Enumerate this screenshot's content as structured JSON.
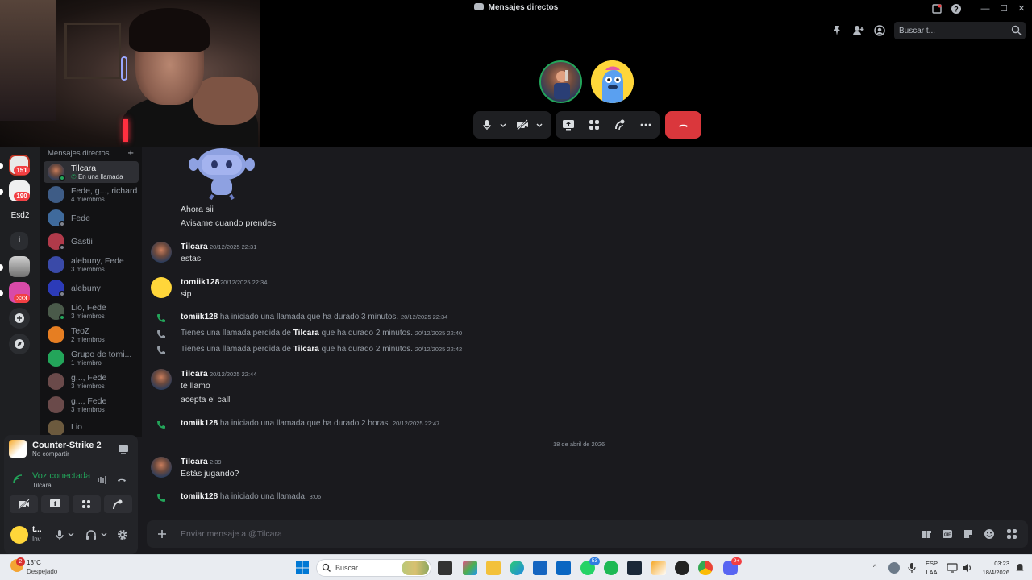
{
  "window": {
    "title": "Mensajes directos"
  },
  "header": {
    "search_placeholder": "Buscar t..."
  },
  "servers": [
    {
      "badge": "151"
    },
    {
      "badge": "190"
    },
    {
      "label": "Esd2"
    },
    {
      "label": "i"
    },
    {
      "badge": ""
    },
    {
      "badge": "333"
    }
  ],
  "sidebar": {
    "header": "Mensajes directos",
    "items": [
      {
        "name": "Tilcara",
        "sub": "En una llamada",
        "active": true
      },
      {
        "name": "Fede, g..., richard",
        "sub": "4 miembros"
      },
      {
        "name": "Fede",
        "sub": ""
      },
      {
        "name": "Gastii",
        "sub": ""
      },
      {
        "name": "alebuny, Fede",
        "sub": "3 miembros"
      },
      {
        "name": "alebuny",
        "sub": ""
      },
      {
        "name": "Lio, Fede",
        "sub": "3 miembros"
      },
      {
        "name": "TeoZ",
        "sub": "2 miembros"
      },
      {
        "name": "Grupo de tomi...",
        "sub": "1 miembro"
      },
      {
        "name": "g..., Fede",
        "sub": "3 miembros"
      },
      {
        "name": "g..., Fede",
        "sub": "3 miembros"
      },
      {
        "name": "Lio",
        "sub": ""
      }
    ]
  },
  "activity": {
    "game": "Counter-Strike 2",
    "sub": "No compartir"
  },
  "voice": {
    "label": "Voz conectada",
    "channel": "Tilcara"
  },
  "user": {
    "name": "t...",
    "status": "Inv..."
  },
  "chat": {
    "messages": [
      {
        "text1": "Ahora sii",
        "text2": "Avisame cuando prendes"
      },
      {
        "author": "Tilcara",
        "time": "20/12/2025 22:31",
        "text": "estas"
      },
      {
        "author": "tomiik128",
        "time": "20/12/2025 22:34",
        "text": "sip"
      },
      {
        "author": "Tilcara",
        "time": "20/12/2025 22:44",
        "text1": "te llamo",
        "text2": "acepta el call"
      },
      {
        "author": "Tilcara",
        "time": "2:39",
        "text": "Estás jugando?"
      }
    ],
    "system": [
      {
        "actor": "tomiik128",
        "text": " ha iniciado una llamada que ha durado 3 minutos. ",
        "time": "20/12/2025 22:34"
      },
      {
        "prefix": "Tienes una llamada perdida de ",
        "actor": "Tilcara",
        "text": " que ha durado 2 minutos. ",
        "time": "20/12/2025 22:40"
      },
      {
        "prefix": "Tienes una llamada perdida de ",
        "actor": "Tilcara",
        "text": " que ha durado 2 minutos. ",
        "time": "20/12/2025 22:42"
      },
      {
        "actor": "tomiik128",
        "text": " ha iniciado una llamada que ha durado 2 horas. ",
        "time": "20/12/2025 22:47"
      },
      {
        "actor": "tomiik128",
        "text": " ha iniciado una llamada. ",
        "time": "3:06"
      }
    ],
    "date_divider": "18 de abril de 2026"
  },
  "composer": {
    "placeholder": "Enviar mensaje a @Tilcara"
  },
  "taskbar": {
    "weather_badge": "2",
    "temp": "13°C",
    "weather": "Despejado",
    "search": "Buscar",
    "whatsapp_badge": "53",
    "discord_badge": "9+",
    "lang1": "ESP",
    "lang2": "LAA",
    "time": "03:23",
    "date": "18/4/2026"
  },
  "colors": {
    "accent_green": "#23a55a",
    "end_call_red": "#da373c",
    "badge_red": "#f23f43",
    "background": "#1a1a1e"
  }
}
